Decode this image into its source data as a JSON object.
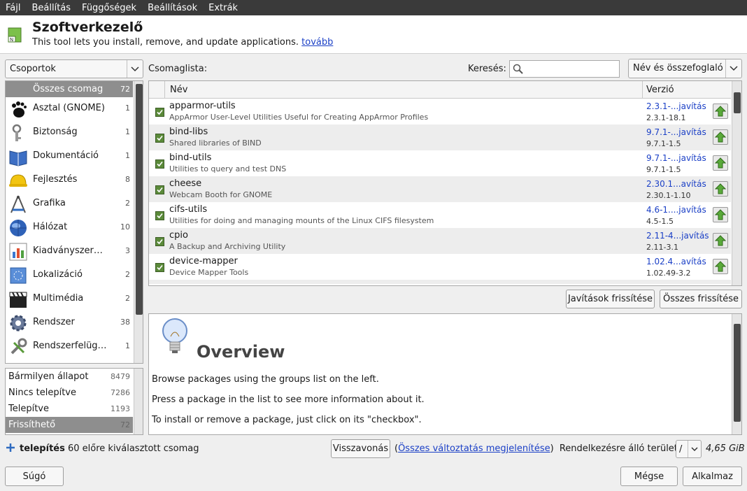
{
  "menu": [
    "Fájl",
    "Beállítás",
    "Függőségek",
    "Beállítások",
    "Extrák"
  ],
  "header": {
    "title": "Szoftverkezelő",
    "subtitle": "This tool lets you install, remove, and update applications.",
    "more_link": "tovább"
  },
  "groups_combo": "Csoportok",
  "groups": [
    {
      "label": "Összes csomag",
      "count": "72",
      "icon": "all-packages-icon",
      "selected": true
    },
    {
      "label": "Asztal (GNOME)",
      "count": "1",
      "icon": "gnome-foot-icon"
    },
    {
      "label": "Biztonság",
      "count": "1",
      "icon": "keys-icon"
    },
    {
      "label": "Dokumentáció",
      "count": "1",
      "icon": "book-icon"
    },
    {
      "label": "Fejlesztés",
      "count": "8",
      "icon": "hard-hat-icon"
    },
    {
      "label": "Grafika",
      "count": "2",
      "icon": "drawing-tools-icon"
    },
    {
      "label": "Hálózat",
      "count": "10",
      "icon": "globe-icon"
    },
    {
      "label": "Kiadványszer…",
      "count": "3",
      "icon": "chart-icon"
    },
    {
      "label": "Lokalizáció",
      "count": "2",
      "icon": "flag-icon"
    },
    {
      "label": "Multimédia",
      "count": "2",
      "icon": "clapperboard-icon"
    },
    {
      "label": "Rendszer",
      "count": "38",
      "icon": "gear-icon"
    },
    {
      "label": "Rendszerfelüg…",
      "count": "1",
      "icon": "wrench-icon"
    }
  ],
  "status_filters": [
    {
      "label": "Bármilyen állapot",
      "count": "8479"
    },
    {
      "label": "Nincs telepítve",
      "count": "7286"
    },
    {
      "label": "Telepítve",
      "count": "1193"
    },
    {
      "label": "Frissíthető",
      "count": "72",
      "selected": true
    }
  ],
  "list_label": "Csomaglista:",
  "search_label": "Keresés:",
  "search_value": "",
  "search_mode": "Név és összefoglaló",
  "columns": {
    "name": "Név",
    "version": "Verzió"
  },
  "packages": [
    {
      "name": "apparmor-utils",
      "desc": "AppArmor User-Level Utilities Useful for Creating AppArmor Profiles",
      "new_ver": "2.3.1-...javítás",
      "old_ver": "2.3.1-18.1"
    },
    {
      "name": "bind-libs",
      "desc": "Shared libraries of BIND",
      "new_ver": "9.7.1-...javítás",
      "old_ver": "9.7.1-1.5"
    },
    {
      "name": "bind-utils",
      "desc": "Utilities to query and test DNS",
      "new_ver": "9.7.1-...javítás",
      "old_ver": "9.7.1-1.5"
    },
    {
      "name": "cheese",
      "desc": "Webcam Booth for GNOME",
      "new_ver": "2.30.1...avítás",
      "old_ver": "2.30.1-1.10"
    },
    {
      "name": "cifs-utils",
      "desc": "Utilities for doing and managing mounts of the Linux CIFS filesystem",
      "new_ver": "4.6-1....javítás",
      "old_ver": "4.5-1.5"
    },
    {
      "name": "cpio",
      "desc": "A Backup and Archiving Utility",
      "new_ver": "2.11-4...javítás",
      "old_ver": "2.11-3.1"
    },
    {
      "name": "device-mapper",
      "desc": "Device Mapper Tools",
      "new_ver": "1.02.4...avítás",
      "old_ver": "1.02.49-3.2"
    }
  ],
  "buttons": {
    "refresh_patches": "Javítások frissítése",
    "refresh_all": "Összes frissítése",
    "undo": "Visszavonás",
    "help": "Súgó",
    "cancel": "Mégse",
    "apply": "Alkalmaz"
  },
  "overview": {
    "heading": "Overview",
    "line1": "Browse packages using the groups list on the left.",
    "line2": "Press a package in the list to see more information about it.",
    "line3": "To install or remove a package, just click on its \"checkbox\"."
  },
  "bottom": {
    "install_bold": "telepítés",
    "install_rest": "60 előre kiválasztott csomag",
    "paren_open": "(",
    "show_changes": "Összes változtatás megjelenítése",
    "paren_close": ")",
    "space_label": "Rendelkezésre álló terület:",
    "mount": "/",
    "space_value": "4,65 GiB"
  }
}
